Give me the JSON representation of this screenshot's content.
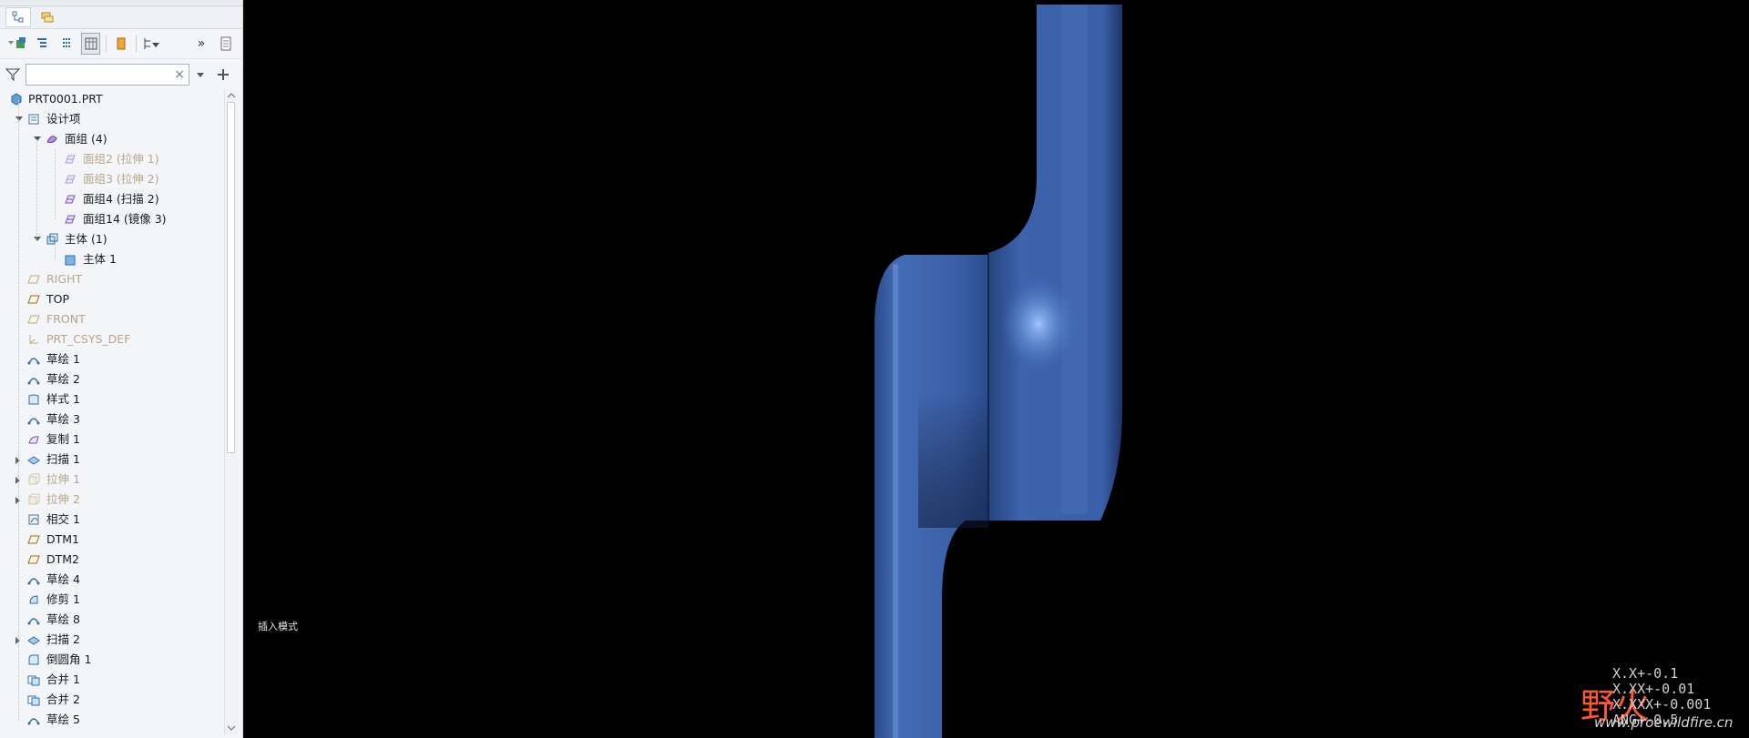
{
  "filter": {
    "placeholder": ""
  },
  "tree": {
    "root": "PRT0001.PRT",
    "items": [
      {
        "label": "设计项",
        "level": 1,
        "toggle": "open",
        "icon": "design-items-icon",
        "dim": false
      },
      {
        "label": "面组 (4)",
        "level": 2,
        "toggle": "open",
        "icon": "quilt-group-icon",
        "dim": false
      },
      {
        "label": "面组2 (拉伸 1)",
        "level": 3,
        "toggle": "",
        "icon": "quilt-icon",
        "dim": true
      },
      {
        "label": "面组3 (拉伸 2)",
        "level": 3,
        "toggle": "",
        "icon": "quilt-icon",
        "dim": true
      },
      {
        "label": "面组4 (扫描 2)",
        "level": 3,
        "toggle": "",
        "icon": "quilt-icon",
        "dim": false
      },
      {
        "label": "面组14 (镜像 3)",
        "level": 3,
        "toggle": "",
        "icon": "quilt-icon",
        "dim": false
      },
      {
        "label": "主体 (1)",
        "level": 2,
        "toggle": "open",
        "icon": "body-group-icon",
        "dim": false
      },
      {
        "label": "主体 1",
        "level": 3,
        "toggle": "",
        "icon": "body-icon",
        "dim": false
      },
      {
        "label": "RIGHT",
        "level": 1,
        "toggle": "",
        "icon": "datum-plane-icon",
        "dim": true
      },
      {
        "label": "TOP",
        "level": 1,
        "toggle": "",
        "icon": "datum-plane-icon",
        "dim": false
      },
      {
        "label": "FRONT",
        "level": 1,
        "toggle": "",
        "icon": "datum-plane-icon",
        "dim": true
      },
      {
        "label": "PRT_CSYS_DEF",
        "level": 1,
        "toggle": "",
        "icon": "csys-icon",
        "dim": true
      },
      {
        "label": "草绘 1",
        "level": 1,
        "toggle": "",
        "icon": "sketch-icon",
        "dim": false
      },
      {
        "label": "草绘 2",
        "level": 1,
        "toggle": "",
        "icon": "sketch-icon",
        "dim": false
      },
      {
        "label": "样式 1",
        "level": 1,
        "toggle": "",
        "icon": "style-icon",
        "dim": false
      },
      {
        "label": "草绘 3",
        "level": 1,
        "toggle": "",
        "icon": "sketch-icon",
        "dim": false
      },
      {
        "label": "复制 1",
        "level": 1,
        "toggle": "",
        "icon": "copy-icon",
        "dim": false
      },
      {
        "label": "扫描 1",
        "level": 1,
        "toggle": "closed",
        "icon": "sweep-icon",
        "dim": false
      },
      {
        "label": "拉伸 1",
        "level": 1,
        "toggle": "closed",
        "icon": "extrude-icon",
        "dim": true
      },
      {
        "label": "拉伸 2",
        "level": 1,
        "toggle": "closed",
        "icon": "extrude-icon",
        "dim": true
      },
      {
        "label": "相交 1",
        "level": 1,
        "toggle": "",
        "icon": "intersect-icon",
        "dim": false
      },
      {
        "label": "DTM1",
        "level": 1,
        "toggle": "",
        "icon": "datum-plane-icon",
        "dim": false
      },
      {
        "label": "DTM2",
        "level": 1,
        "toggle": "",
        "icon": "datum-plane-icon",
        "dim": false
      },
      {
        "label": "草绘 4",
        "level": 1,
        "toggle": "",
        "icon": "sketch-icon",
        "dim": false
      },
      {
        "label": "修剪 1",
        "level": 1,
        "toggle": "",
        "icon": "trim-icon",
        "dim": false
      },
      {
        "label": "草绘 8",
        "level": 1,
        "toggle": "",
        "icon": "sketch-icon",
        "dim": false
      },
      {
        "label": "扫描 2",
        "level": 1,
        "toggle": "closed",
        "icon": "sweep-icon",
        "dim": false
      },
      {
        "label": "倒圆角 1",
        "level": 1,
        "toggle": "",
        "icon": "round-icon",
        "dim": false
      },
      {
        "label": "合并 1",
        "level": 1,
        "toggle": "",
        "icon": "merge-icon",
        "dim": false
      },
      {
        "label": "合并 2",
        "level": 1,
        "toggle": "",
        "icon": "merge-icon",
        "dim": false
      },
      {
        "label": "草绘 5",
        "level": 1,
        "toggle": "",
        "icon": "sketch-icon",
        "dim": false
      }
    ]
  },
  "viewport": {
    "mode_text": "插入模式",
    "watermark": {
      "logo": "野火",
      "site": "www.proewildfire.cn",
      "tolerances": [
        "X.X+-0.1",
        "X.XX+-0.01",
        "X.XXX+-0.001",
        "ANG+-0.5"
      ]
    }
  },
  "colors": {
    "part_blue": "#3f67b3",
    "part_dark": "#1f3a74",
    "panel_bg": "#f3f5f8",
    "dim_text": "#b8a58a"
  }
}
